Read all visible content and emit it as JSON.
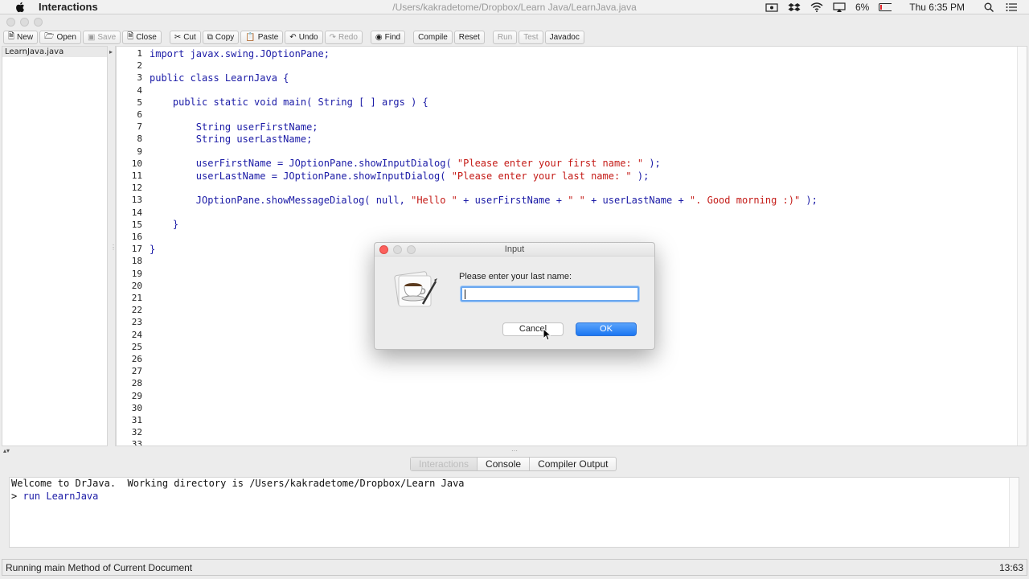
{
  "menubar": {
    "app_name": "Interactions",
    "window_path": "/Users/kakradetome/Dropbox/Learn Java/LearnJava.java",
    "battery": "6%",
    "clock": "Thu 6:35 PM"
  },
  "toolbar": {
    "new": "New",
    "open": "Open",
    "save": "Save",
    "close": "Close",
    "cut": "Cut",
    "copy": "Copy",
    "paste": "Paste",
    "undo": "Undo",
    "redo": "Redo",
    "find": "Find",
    "compile": "Compile",
    "reset": "Reset",
    "run": "Run",
    "test": "Test",
    "javadoc": "Javadoc"
  },
  "files": [
    "LearnJava.java"
  ],
  "editor": {
    "lines": [
      {
        "n": "1",
        "segs": [
          {
            "t": "import javax.swing.JOptionPane;",
            "c": "plain"
          }
        ]
      },
      {
        "n": "2",
        "segs": []
      },
      {
        "n": "3",
        "segs": [
          {
            "t": "public class LearnJava {",
            "c": "plain"
          }
        ]
      },
      {
        "n": "4",
        "segs": []
      },
      {
        "n": "5",
        "segs": [
          {
            "t": "    public static void main( String [ ] args ) {",
            "c": "plain"
          }
        ]
      },
      {
        "n": "6",
        "segs": []
      },
      {
        "n": "7",
        "segs": [
          {
            "t": "        String userFirstName;",
            "c": "plain"
          }
        ]
      },
      {
        "n": "8",
        "segs": [
          {
            "t": "        String userLastName;",
            "c": "plain"
          }
        ]
      },
      {
        "n": "9",
        "segs": []
      },
      {
        "n": "10",
        "segs": [
          {
            "t": "        userFirstName = JOptionPane.showInputDialog( ",
            "c": "plain"
          },
          {
            "t": "\"Please enter your first name: \"",
            "c": "str"
          },
          {
            "t": " );",
            "c": "plain"
          }
        ]
      },
      {
        "n": "11",
        "segs": [
          {
            "t": "        userLastName = JOptionPane.showInputDialog( ",
            "c": "plain"
          },
          {
            "t": "\"Please enter your last name: \"",
            "c": "str"
          },
          {
            "t": " );",
            "c": "plain"
          }
        ]
      },
      {
        "n": "12",
        "segs": []
      },
      {
        "n": "13",
        "segs": [
          {
            "t": "        JOptionPane.showMessageDialog( null, ",
            "c": "plain"
          },
          {
            "t": "\"Hello \"",
            "c": "str"
          },
          {
            "t": " + userFirstName + ",
            "c": "plain"
          },
          {
            "t": "\" \"",
            "c": "str"
          },
          {
            "t": " + userLastName + ",
            "c": "plain"
          },
          {
            "t": "\". Good morning :)\"",
            "c": "str"
          },
          {
            "t": " );",
            "c": "plain"
          }
        ]
      },
      {
        "n": "14",
        "segs": []
      },
      {
        "n": "15",
        "segs": [
          {
            "t": "    }",
            "c": "plain"
          }
        ]
      },
      {
        "n": "16",
        "segs": []
      },
      {
        "n": "17",
        "segs": [
          {
            "t": "}",
            "c": "plain"
          }
        ]
      },
      {
        "n": "18",
        "segs": []
      },
      {
        "n": "19",
        "segs": []
      },
      {
        "n": "20",
        "segs": []
      },
      {
        "n": "21",
        "segs": []
      },
      {
        "n": "22",
        "segs": []
      },
      {
        "n": "23",
        "segs": []
      },
      {
        "n": "24",
        "segs": []
      },
      {
        "n": "25",
        "segs": []
      },
      {
        "n": "26",
        "segs": []
      },
      {
        "n": "27",
        "segs": []
      },
      {
        "n": "28",
        "segs": []
      },
      {
        "n": "29",
        "segs": []
      },
      {
        "n": "30",
        "segs": []
      },
      {
        "n": "31",
        "segs": []
      },
      {
        "n": "32",
        "segs": []
      },
      {
        "n": "33",
        "segs": []
      }
    ]
  },
  "dialog": {
    "title": "Input",
    "prompt": "Please enter your last name:",
    "input_value": "",
    "cancel": "Cancel",
    "ok": "OK"
  },
  "bottom_tabs": [
    {
      "label": "Interactions",
      "active": true
    },
    {
      "label": "Console",
      "active": false
    },
    {
      "label": "Compiler Output",
      "active": false
    }
  ],
  "console": {
    "line1": "Welcome to DrJava.  Working directory is /Users/kakradetome/Dropbox/Learn Java",
    "prompt": "> ",
    "command": "run LearnJava"
  },
  "status": {
    "message": "Running main Method of Current Document",
    "position": "13:63"
  },
  "colors": {
    "code_blue": "#1a1aa6",
    "string_red": "#c41a16",
    "ok_blue": "#1c76f2",
    "close_red": "#fc605c"
  }
}
